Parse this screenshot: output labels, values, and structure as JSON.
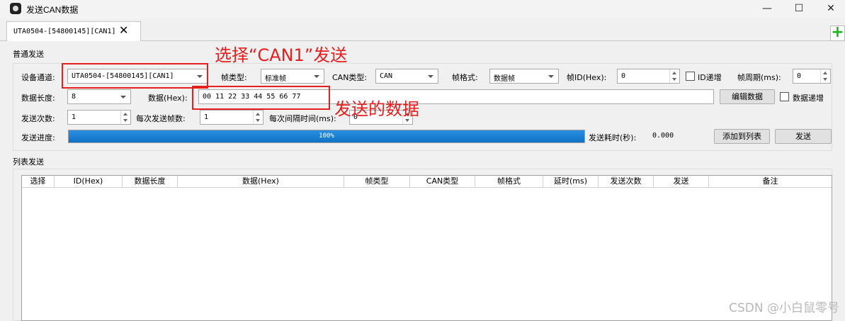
{
  "window": {
    "title": "发送CAN数据",
    "controls": [
      "—",
      "☐",
      "✕"
    ]
  },
  "tab": {
    "label": "UTA0504-[54800145][CAN1]",
    "close": "✕",
    "add": "+"
  },
  "normal_send": {
    "group_label": "普通发送",
    "channel": {
      "label": "设备通道:",
      "value": "UTA0504-[54800145][CAN1]"
    },
    "frame_type": {
      "label": "帧类型:",
      "value": "标准帧"
    },
    "can_type": {
      "label": "CAN类型:",
      "value": "CAN"
    },
    "frame_format": {
      "label": "帧格式:",
      "value": "数据帧"
    },
    "frame_id": {
      "label": "帧ID(Hex):",
      "value": "0"
    },
    "id_increment": {
      "label": "ID递增",
      "checked": false
    },
    "frame_period": {
      "label": "帧周期(ms):",
      "value": "0"
    },
    "data_length": {
      "label": "数据长度:",
      "value": "8"
    },
    "data_hex": {
      "label": "数据(Hex):",
      "value": "00 11 22 33 44 55 66 77"
    },
    "edit_data_button": "编辑数据",
    "data_increment": {
      "label": "数据递增",
      "checked": false
    },
    "send_count": {
      "label": "发送次数:",
      "value": "1"
    },
    "frames_per_send": {
      "label": "每次发送帧数:",
      "value": "1"
    },
    "interval": {
      "label": "每次间隔时间(ms):",
      "value": "0"
    },
    "progress": {
      "label": "发送进度:",
      "value": 1.0,
      "text": "100%"
    },
    "elapsed": {
      "label": "发送耗时(秒):",
      "value": "0.000"
    },
    "add_to_list_button": "添加到列表",
    "send_button": "发送"
  },
  "list_send": {
    "group_label": "列表发送",
    "columns": [
      "选择",
      "ID(Hex)",
      "数据长度",
      "数据(Hex)",
      "帧类型",
      "CAN类型",
      "帧格式",
      "延时(ms)",
      "发送次数",
      "发送",
      "备注"
    ],
    "rows": []
  },
  "annotations": {
    "select_note": "选择“CAN1”发送",
    "data_note": "发送的数据",
    "color": "#e81e1e"
  },
  "watermark": "CSDN @小白鼠零号"
}
